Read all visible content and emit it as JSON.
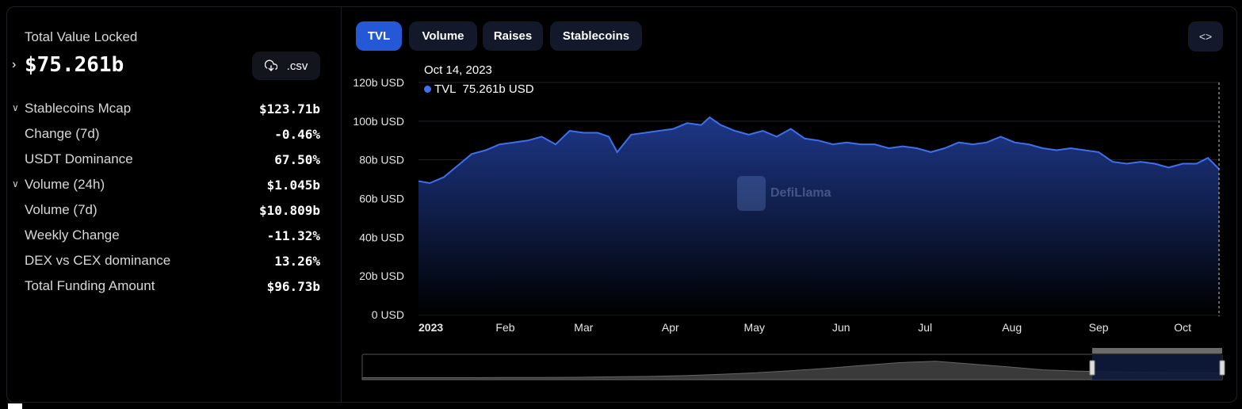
{
  "stats": {
    "tvl_label": "Total Value Locked",
    "tvl_value": "$75.261b",
    "csv_label": ".csv",
    "rows": [
      {
        "label": "Stablecoins Mcap",
        "value": "$123.71b",
        "expandable": true
      },
      {
        "label": "Change (7d)",
        "value": "-0.46%",
        "expandable": false
      },
      {
        "label": "USDT Dominance",
        "value": "67.50%",
        "expandable": false
      },
      {
        "label": "Volume (24h)",
        "value": "$1.045b",
        "expandable": true
      },
      {
        "label": "Volume (7d)",
        "value": "$10.809b",
        "expandable": false
      },
      {
        "label": "Weekly Change",
        "value": "-11.32%",
        "expandable": false
      },
      {
        "label": "DEX vs CEX dominance",
        "value": "13.26%",
        "expandable": false
      },
      {
        "label": "Total Funding Amount",
        "value": "$96.73b",
        "expandable": false
      }
    ]
  },
  "tabs": [
    "TVL",
    "Volume",
    "Raises",
    "Stablecoins"
  ],
  "active_tab": "TVL",
  "embed_icon": "code-brackets-icon",
  "tooltip": {
    "date": "Oct 14, 2023",
    "series_label": "TVL",
    "series_value": "75.261b USD"
  },
  "watermark": "DefiLlama",
  "colors": {
    "accent": "#2558d6",
    "line": "#3d6ff0",
    "area_top": "#1f3a8f",
    "tab_bg": "#13192b"
  },
  "chart_data": {
    "type": "area",
    "title": "",
    "xlabel": "",
    "ylabel": "",
    "y_ticks": [
      "0 USD",
      "20b USD",
      "40b USD",
      "60b USD",
      "80b USD",
      "100b USD",
      "120b USD"
    ],
    "ylim": [
      0,
      120
    ],
    "x_ticks": [
      "2023",
      "Feb",
      "Mar",
      "Apr",
      "May",
      "Jun",
      "Jul",
      "Aug",
      "Sep",
      "Oct"
    ],
    "grid": true,
    "series": [
      {
        "name": "TVL",
        "unit": "b USD",
        "x": [
          "2023-01-01",
          "2023-01-05",
          "2023-01-10",
          "2023-01-15",
          "2023-01-20",
          "2023-01-25",
          "2023-01-30",
          "2023-02-04",
          "2023-02-09",
          "2023-02-14",
          "2023-02-19",
          "2023-02-24",
          "2023-03-01",
          "2023-03-06",
          "2023-03-10",
          "2023-03-13",
          "2023-03-18",
          "2023-03-23",
          "2023-03-28",
          "2023-04-02",
          "2023-04-07",
          "2023-04-12",
          "2023-04-15",
          "2023-04-19",
          "2023-04-24",
          "2023-04-29",
          "2023-05-04",
          "2023-05-09",
          "2023-05-14",
          "2023-05-19",
          "2023-05-24",
          "2023-05-29",
          "2023-06-03",
          "2023-06-08",
          "2023-06-13",
          "2023-06-18",
          "2023-06-23",
          "2023-06-28",
          "2023-07-03",
          "2023-07-08",
          "2023-07-13",
          "2023-07-18",
          "2023-07-23",
          "2023-07-28",
          "2023-08-02",
          "2023-08-07",
          "2023-08-12",
          "2023-08-17",
          "2023-08-22",
          "2023-08-27",
          "2023-09-01",
          "2023-09-06",
          "2023-09-11",
          "2023-09-16",
          "2023-09-21",
          "2023-09-26",
          "2023-10-01",
          "2023-10-06",
          "2023-10-10",
          "2023-10-14"
        ],
        "values": [
          69,
          68,
          71,
          77,
          83,
          85,
          88,
          89,
          90,
          92,
          88,
          95,
          94,
          94,
          92,
          84,
          93,
          94,
          95,
          96,
          99,
          98,
          102,
          98,
          95,
          93,
          95,
          92,
          96,
          91,
          90,
          88,
          89,
          88,
          88,
          86,
          87,
          86,
          84,
          86,
          89,
          88,
          89,
          92,
          89,
          88,
          86,
          85,
          86,
          85,
          84,
          79,
          78,
          79,
          78,
          76,
          78,
          78,
          81,
          75.261
        ]
      }
    ]
  }
}
